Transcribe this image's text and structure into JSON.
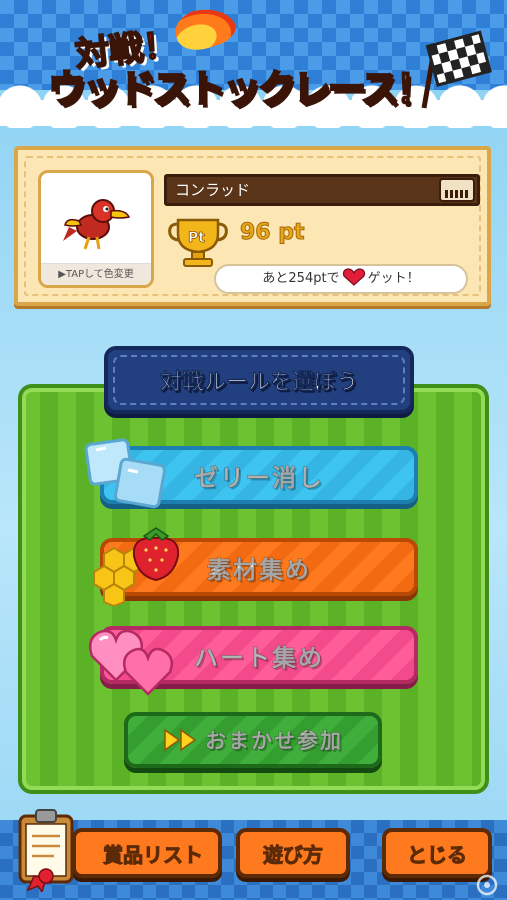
{
  "header": {
    "title_sub": "対戦！",
    "title_main": "ウッドストックレース！"
  },
  "profile": {
    "avatar_label": "▶TAPして色変更",
    "player_name": "コンラッド",
    "points": "96 pt",
    "hint_prefix": "あと254ptで",
    "hint_suffix": "ゲット！"
  },
  "rules": {
    "banner": "対戦ルールを選ぼう",
    "options": [
      {
        "label": "ゼリー消し"
      },
      {
        "label": "素材集め"
      },
      {
        "label": "ハート集め"
      },
      {
        "label": "おまかせ参加"
      }
    ]
  },
  "footer": {
    "prizes": "賞品リスト",
    "howto": "遊び方",
    "close": "とじる"
  },
  "colors": {
    "jelly": "#3ec4f0",
    "material": "#ff7a1e",
    "heart": "#ff5d9a",
    "auto": "#3fae3a",
    "banner": "#22407f"
  }
}
